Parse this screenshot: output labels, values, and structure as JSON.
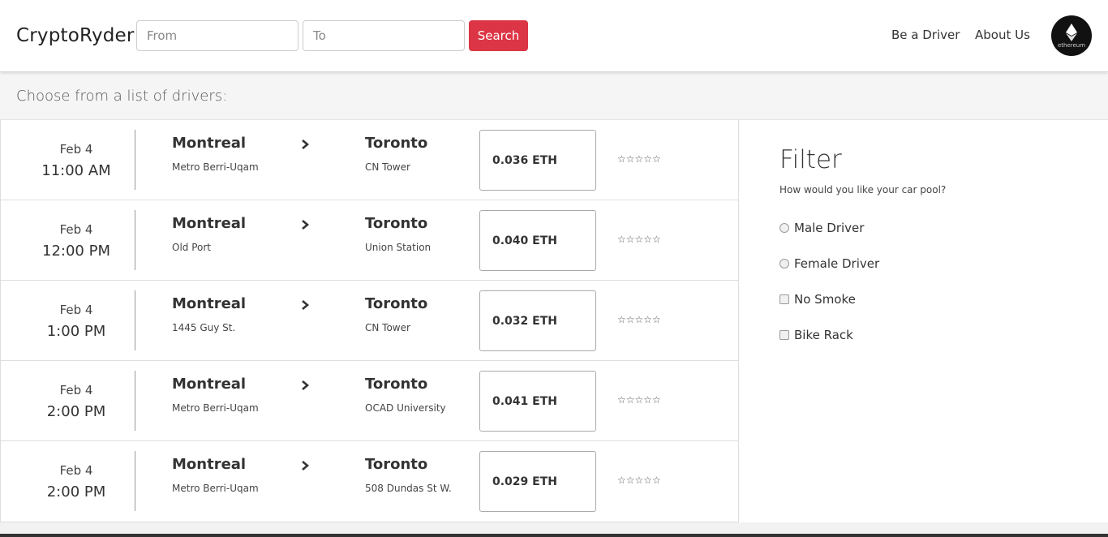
{
  "header": {
    "brand": "CryptoRyder",
    "from_placeholder": "From",
    "to_placeholder": "To",
    "search_label": "Search",
    "nav": [
      "Be a Driver",
      "About Us"
    ],
    "logo_text": "ethereum"
  },
  "subheader": {
    "title": "Choose from a list of drivers:"
  },
  "rides": [
    {
      "date": "Feb 4",
      "time": "11:00 AM",
      "from_city": "Montreal",
      "from_place": "Metro Berri-Uqam",
      "to_city": "Toronto",
      "to_place": "CN Tower",
      "price": "0.036 ETH",
      "stars": "☆☆☆☆☆"
    },
    {
      "date": "Feb 4",
      "time": "12:00 PM",
      "from_city": "Montreal",
      "from_place": "Old Port",
      "to_city": "Toronto",
      "to_place": "Union Station",
      "price": "0.040 ETH",
      "stars": "☆☆☆☆☆"
    },
    {
      "date": "Feb 4",
      "time": "1:00 PM",
      "from_city": "Montreal",
      "from_place": "1445 Guy St.",
      "to_city": "Toronto",
      "to_place": "CN Tower",
      "price": "0.032 ETH",
      "stars": "☆☆☆☆☆"
    },
    {
      "date": "Feb 4",
      "time": "2:00 PM",
      "from_city": "Montreal",
      "from_place": "Metro Berri-Uqam",
      "to_city": "Toronto",
      "to_place": "OCAD University",
      "price": "0.041 ETH",
      "stars": "☆☆☆☆☆"
    },
    {
      "date": "Feb 4",
      "time": "2:00 PM",
      "from_city": "Montreal",
      "from_place": "Metro Berri-Uqam",
      "to_city": "Toronto",
      "to_place": "508 Dundas St W.",
      "price": "0.029 ETH",
      "stars": "☆☆☆☆☆"
    }
  ],
  "filter": {
    "title": "Filter",
    "question": "How would you like your car pool?",
    "options": [
      {
        "label": "Male Driver",
        "type": "radio"
      },
      {
        "label": "Female Driver",
        "type": "radio"
      },
      {
        "label": "No Smoke",
        "type": "checkbox"
      },
      {
        "label": "Bike Rack",
        "type": "checkbox"
      }
    ]
  },
  "colors": {
    "search_button": "#dc3545",
    "subheader_bg": "#f5f5f5"
  }
}
